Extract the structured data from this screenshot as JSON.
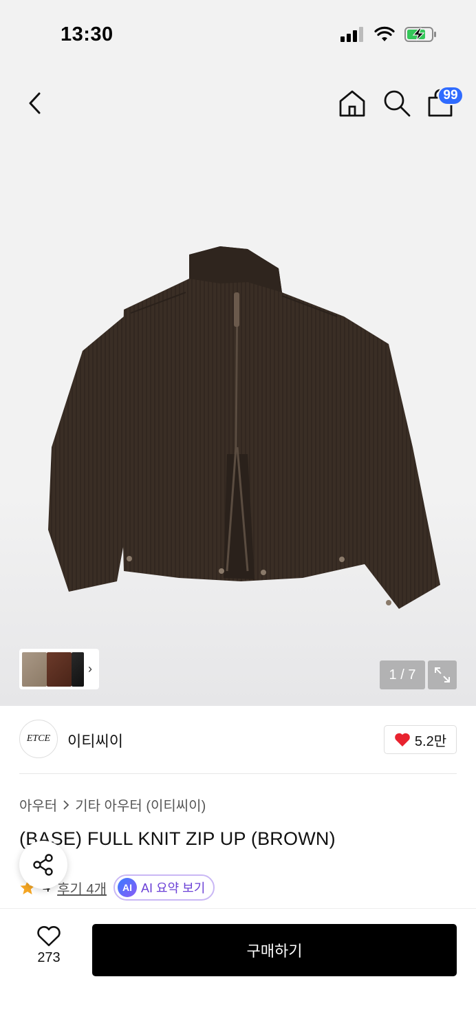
{
  "status_bar": {
    "time": "13:30"
  },
  "nav": {
    "cart_count": "99"
  },
  "gallery": {
    "counter": "1 / 7"
  },
  "brand": {
    "logo_text": "ETCE",
    "name": "이티씨이",
    "likes": "5.2만"
  },
  "breadcrumb": {
    "category": "아우터",
    "subcategory": "기타 아우터 (이티씨이)"
  },
  "product": {
    "title": "(BASE) FULL KNIT ZIP UP (BROWN)"
  },
  "rating": {
    "value": "4",
    "reviews": "후기 4개",
    "ai_badge": "AI",
    "ai_label": "AI 요약 보기"
  },
  "bottom": {
    "wish_count": "273",
    "buy_label": "구매하기"
  },
  "colors": {
    "accent": "#2f6bff",
    "heart": "#e8232f",
    "jacket": "#3a2e25"
  }
}
